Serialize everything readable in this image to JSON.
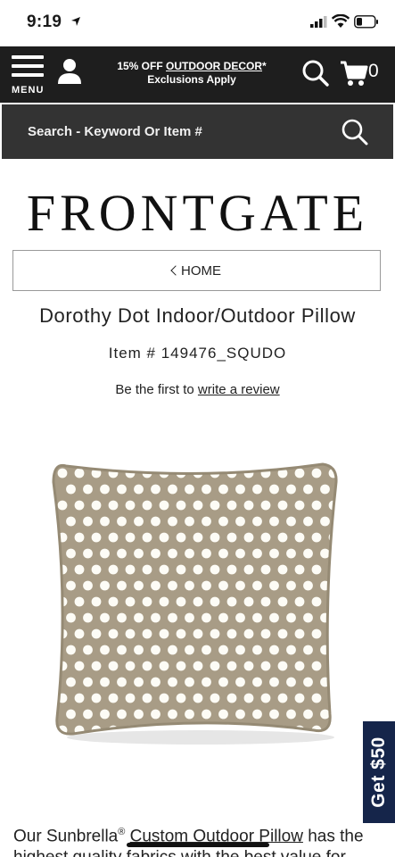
{
  "status_bar": {
    "time": "9:19"
  },
  "top_nav": {
    "menu_label": "MENU",
    "promo_prefix": "15% OFF ",
    "promo_link": "OUTDOOR DECOR",
    "promo_suffix": "*",
    "promo_line2": "Exclusions Apply",
    "cart_count": "0"
  },
  "search": {
    "placeholder": "Search - Keyword Or Item #"
  },
  "brand": {
    "logo_text": "FRONTGATE"
  },
  "breadcrumb": {
    "home_label": "HOME"
  },
  "product": {
    "title": "Dorothy Dot Indoor/Outdoor Pillow",
    "item_number": "Item # 149476_SQUDO",
    "review_prefix": "Be the first to ",
    "review_link": "write a review",
    "pillow_color": "#a89c86",
    "dot_color": "#fdfcf6"
  },
  "promo_tab": {
    "label": "Get $50",
    "color": "#15254a"
  },
  "description": {
    "line1_prefix": "Our Sunbrella",
    "line1_reg": "®",
    "line1_link": "Custom Outdoor Pillow",
    "line1_suffix": " has the",
    "line2": "highest quality fabrics with the best value for"
  }
}
